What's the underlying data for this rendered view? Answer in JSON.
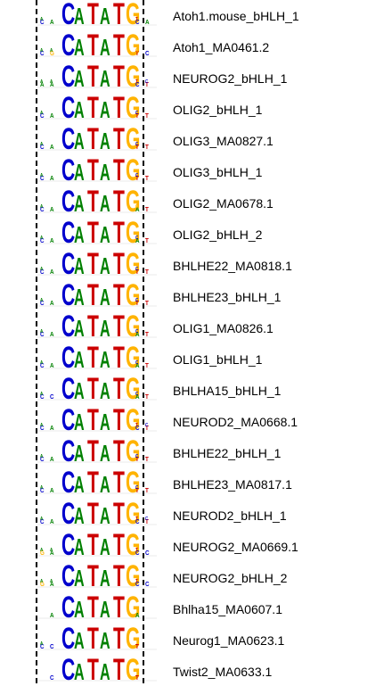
{
  "colors": {
    "A": "#008000",
    "C": "#0000cc",
    "G": "#ffb300",
    "T": "#cc0000",
    "divider": "#000000"
  },
  "motifs": [
    {
      "label": "Atoh1.mouse_bHLH_1",
      "flank_left": [
        "AC",
        "A"
      ],
      "flank_right": [
        "TC",
        "A"
      ]
    },
    {
      "label": "Atoh1_MA0461.2",
      "flank_left": [
        "AC",
        "AG"
      ],
      "flank_right": [
        "GT",
        "C"
      ]
    },
    {
      "label": "NEUROG2_bHLH_1",
      "flank_left": [
        "AA",
        "AA"
      ],
      "flank_right": [
        "TC",
        "CT"
      ]
    },
    {
      "label": "OLIG2_bHLH_1",
      "flank_left": [
        "AC",
        "A"
      ],
      "flank_right": [
        "CT",
        "T"
      ]
    },
    {
      "label": "OLIG3_MA0827.1",
      "flank_left": [
        "AC",
        "A"
      ],
      "flank_right": [
        "CT",
        "T"
      ]
    },
    {
      "label": "OLIG3_bHLH_1",
      "flank_left": [
        "AC",
        "A"
      ],
      "flank_right": [
        "CT",
        "T"
      ]
    },
    {
      "label": "OLIG2_MA0678.1",
      "flank_left": [
        "AC",
        "A"
      ],
      "flank_right": [
        "GA",
        "T"
      ]
    },
    {
      "label": "OLIG2_bHLH_2",
      "flank_left": [
        "AC",
        "A"
      ],
      "flank_right": [
        "CA",
        "T"
      ]
    },
    {
      "label": "BHLHE22_MA0818.1",
      "flank_left": [
        "AC",
        "A"
      ],
      "flank_right": [
        "CT",
        "T"
      ]
    },
    {
      "label": "BHLHE23_bHLH_1",
      "flank_left": [
        "AC",
        "A"
      ],
      "flank_right": [
        "CT",
        "T"
      ]
    },
    {
      "label": "OLIG1_MA0826.1",
      "flank_left": [
        "AC",
        "A"
      ],
      "flank_right": [
        "CA",
        "T"
      ]
    },
    {
      "label": "OLIG1_bHLH_1",
      "flank_left": [
        "AC",
        "A"
      ],
      "flank_right": [
        "CA",
        "T"
      ]
    },
    {
      "label": "BHLHA15_bHLH_1",
      "flank_left": [
        "AC",
        "C"
      ],
      "flank_right": [
        "CA",
        "T"
      ]
    },
    {
      "label": "NEUROD2_MA0668.1",
      "flank_left": [
        "AC",
        "A"
      ],
      "flank_right": [
        "TC",
        "CT"
      ]
    },
    {
      "label": "BHLHE22_bHLH_1",
      "flank_left": [
        "AC",
        "A"
      ],
      "flank_right": [
        "CT",
        "T"
      ]
    },
    {
      "label": "BHLHE23_MA0817.1",
      "flank_left": [
        "AC",
        "A"
      ],
      "flank_right": [
        "CT",
        "T"
      ]
    },
    {
      "label": "NEUROD2_bHLH_1",
      "flank_left": [
        "AC",
        "A"
      ],
      "flank_right": [
        "TC",
        "CT"
      ]
    },
    {
      "label": "NEUROG2_MA0669.1",
      "flank_left": [
        "AG",
        "AA"
      ],
      "flank_right": [
        "TC",
        "C"
      ]
    },
    {
      "label": "NEUROG2_bHLH_2",
      "flank_left": [
        "AG",
        "AA"
      ],
      "flank_right": [
        "TC",
        "C"
      ]
    },
    {
      "label": "Bhlha15_MA0607.1",
      "flank_left": [
        "",
        "A"
      ],
      "flank_right": [
        "A",
        ""
      ]
    },
    {
      "label": "Neurog1_MA0623.1",
      "flank_left": [
        "AC",
        "C"
      ],
      "flank_right": [
        "T",
        ""
      ]
    },
    {
      "label": "Twist2_MA0633.1",
      "flank_left": [
        "",
        "C"
      ],
      "flank_right": [
        "T",
        ""
      ]
    }
  ]
}
